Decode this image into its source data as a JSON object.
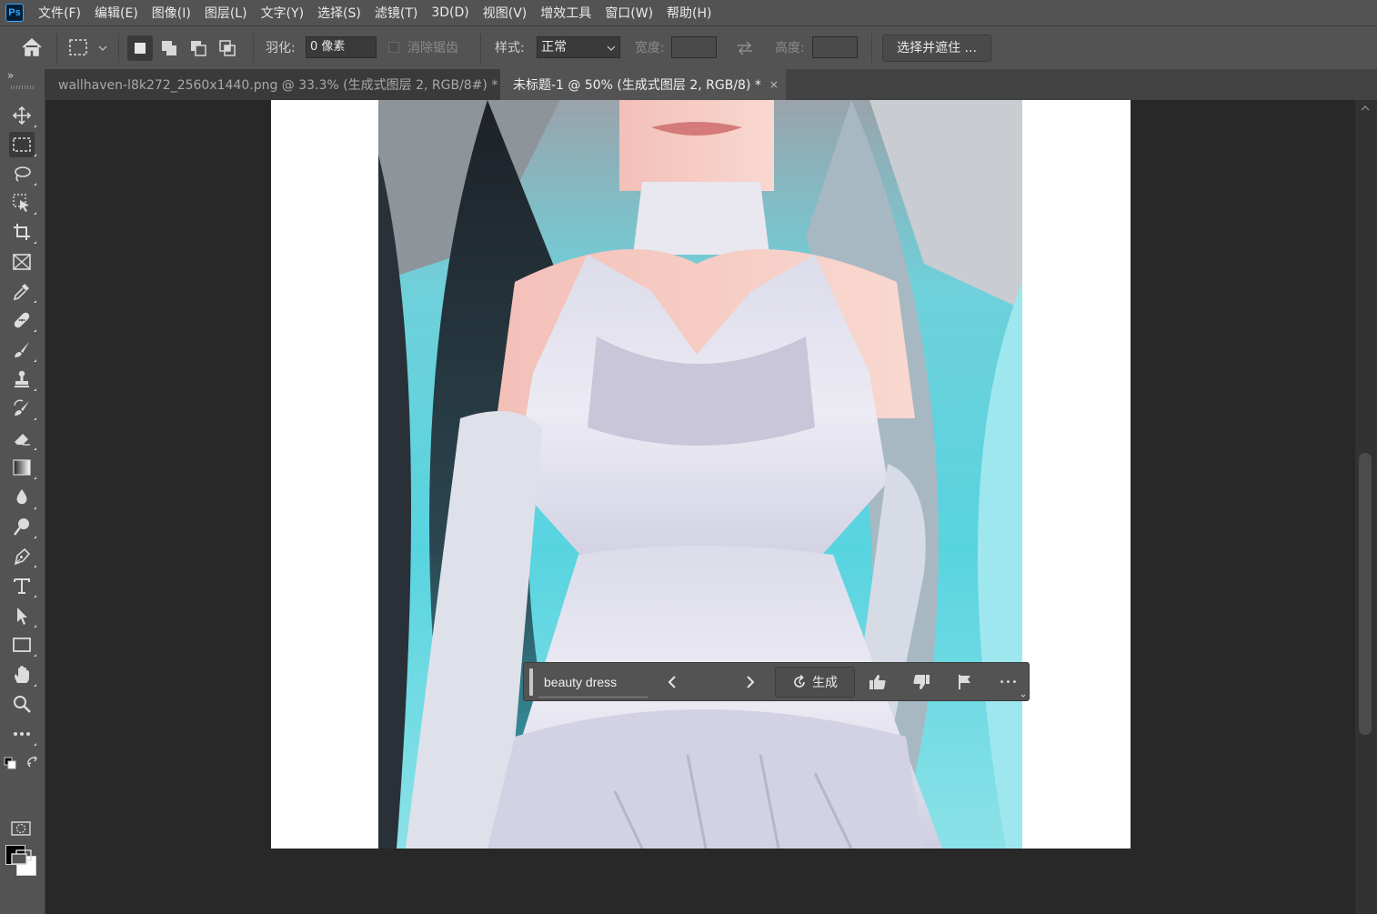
{
  "app": {
    "logo_text": "Ps"
  },
  "menu": [
    "文件(F)",
    "编辑(E)",
    "图像(I)",
    "图层(L)",
    "文字(Y)",
    "选择(S)",
    "滤镜(T)",
    "3D(D)",
    "视图(V)",
    "增效工具",
    "窗口(W)",
    "帮助(H)"
  ],
  "options": {
    "feather_label": "羽化:",
    "feather_value": "0 像素",
    "antialias_label": "消除锯齿",
    "style_label": "样式:",
    "style_value": "正常",
    "width_label": "宽度:",
    "height_label": "高度:",
    "select_mask_label": "选择并遮住 ..."
  },
  "toolbar": {
    "expand_glyph": "»"
  },
  "tabs": [
    {
      "label": "wallhaven-l8k272_2560x1440.png @ 33.3% (生成式图层 2, RGB/8#) *",
      "close": "×",
      "active": false
    },
    {
      "label": "未标题-1 @ 50% (生成式图层 2, RGB/8) *",
      "close": "×",
      "active": true
    }
  ],
  "taskbar": {
    "prompt_value": "beauty dress",
    "generate_label": "生成",
    "more_glyph": "•••"
  },
  "colors": {
    "foreground": "#000000",
    "background": "#ffffff",
    "ui_panel": "#535353",
    "canvas_bg": "#282828"
  },
  "icons": [
    "home-icon",
    "marquee-icon",
    "new-selection-icon",
    "add-selection-icon",
    "subtract-selection-icon",
    "intersect-selection-icon",
    "swap-icon",
    "move-icon",
    "rect-marquee-icon",
    "lasso-icon",
    "object-select-icon",
    "crop-icon",
    "frame-icon",
    "eyedropper-icon",
    "healing-icon",
    "brush-icon",
    "stamp-icon",
    "history-brush-icon",
    "eraser-icon",
    "gradient-icon",
    "blur-icon",
    "dodge-icon",
    "pen-icon",
    "type-icon",
    "path-select-icon",
    "rectangle-icon",
    "hand-icon",
    "zoom-icon",
    "more-tools-icon",
    "thumbs-up-icon",
    "thumbs-down-icon",
    "flag-icon",
    "refresh-icon"
  ]
}
